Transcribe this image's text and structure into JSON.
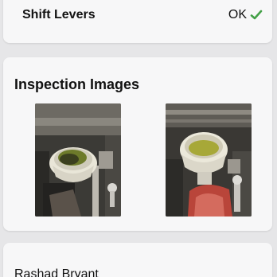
{
  "checklist_item": {
    "label": "Shift Levers",
    "status": "OK",
    "status_icon": "checkmark-icon",
    "status_color": "#43a047"
  },
  "inspection_images": {
    "title": "Inspection Images",
    "images": [
      {
        "name": "engine-reservoir-photo-1"
      },
      {
        "name": "engine-reservoir-photo-2"
      }
    ]
  },
  "technician": {
    "name": "Rashad Bryant"
  }
}
